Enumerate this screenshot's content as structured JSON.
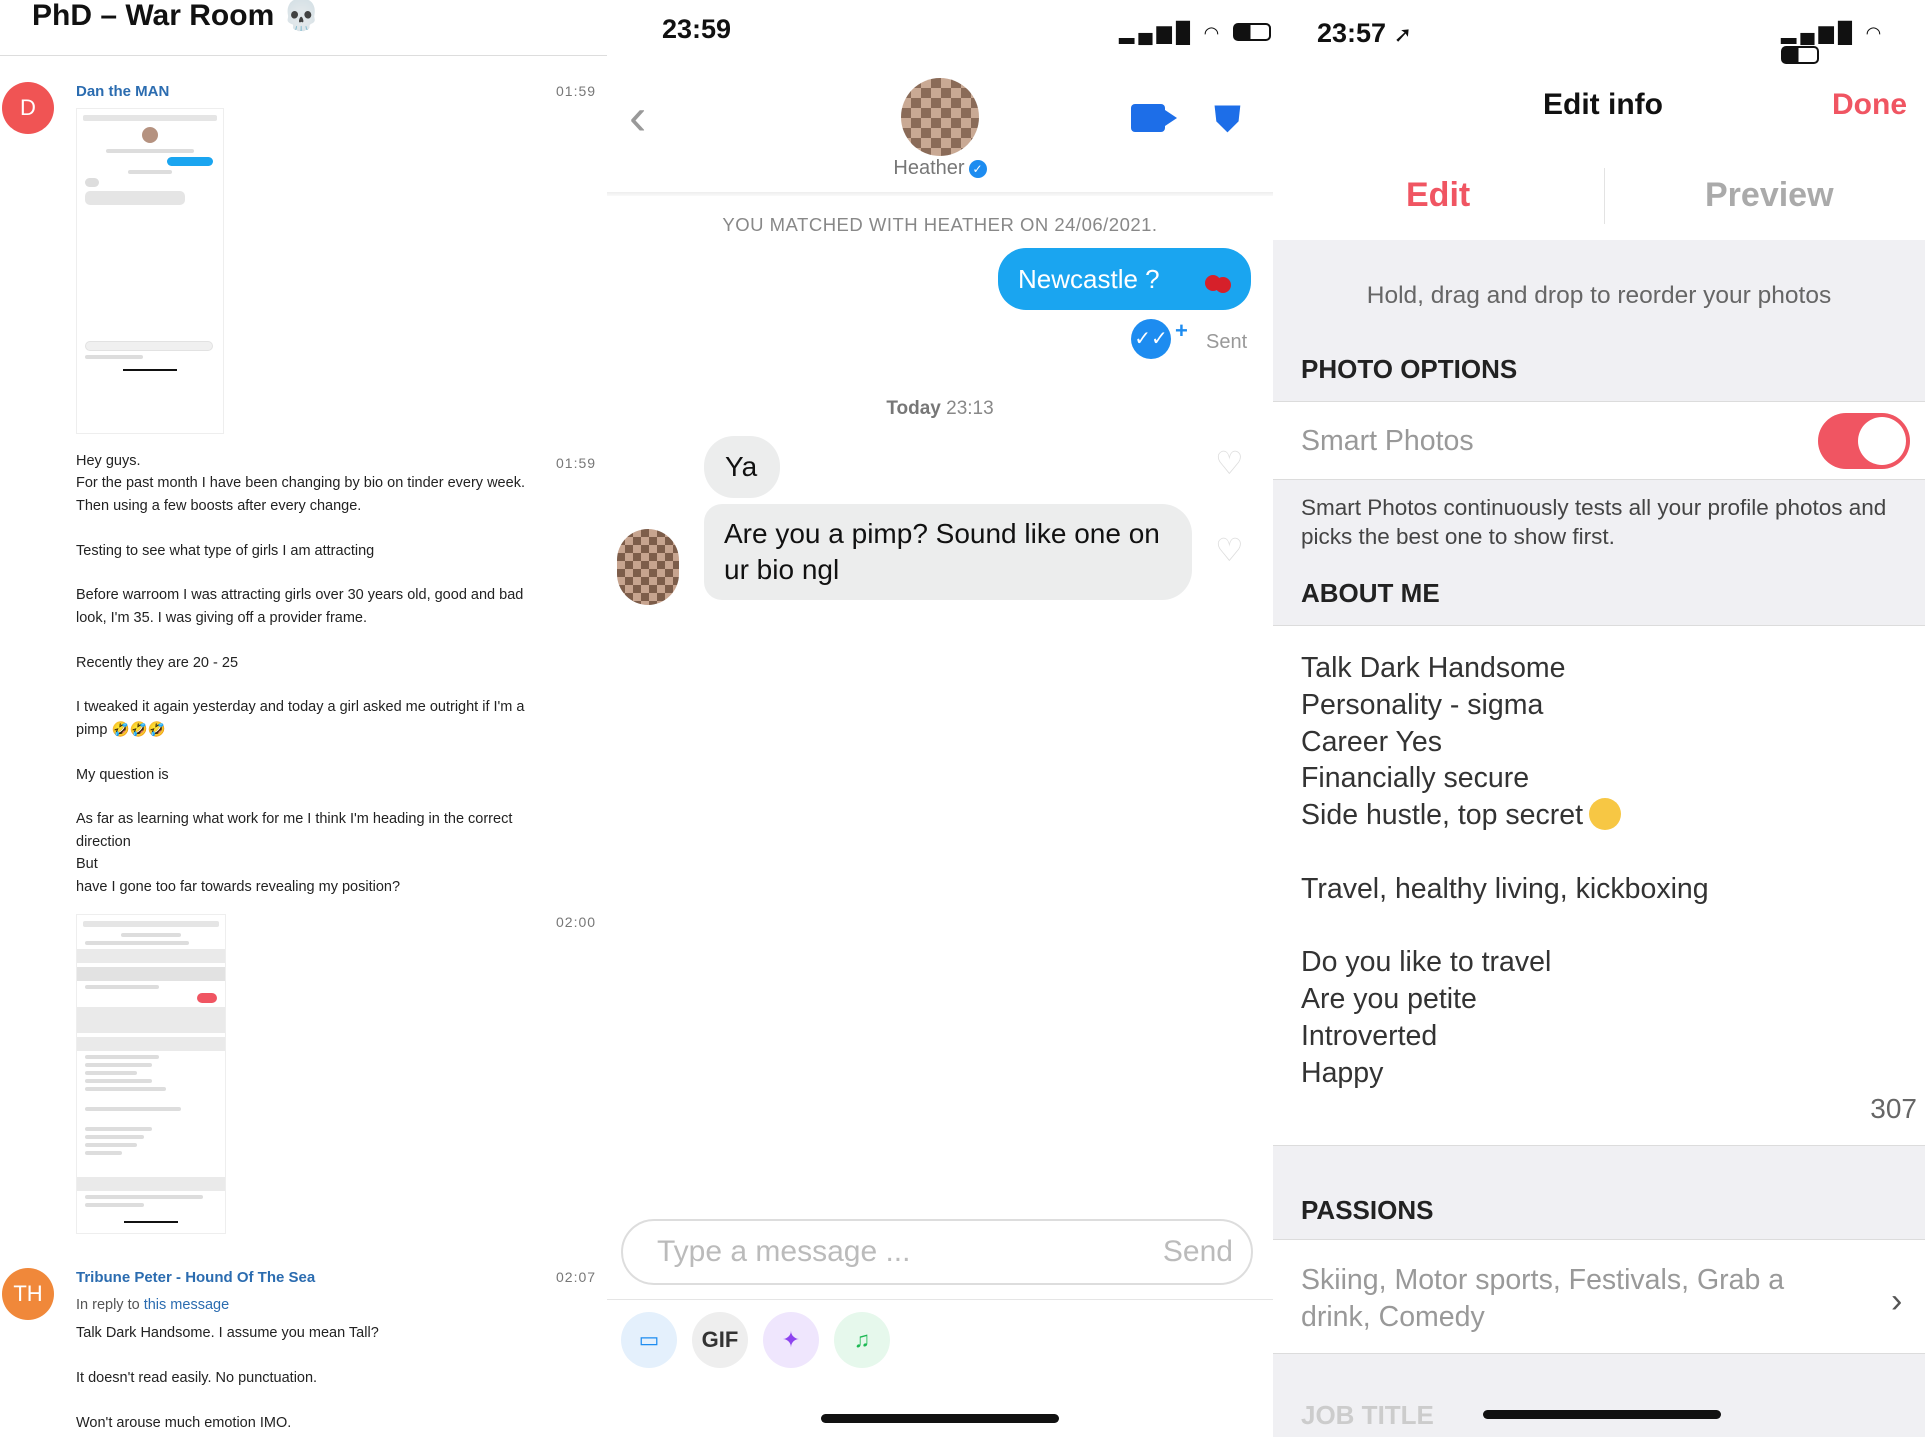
{
  "chat": {
    "title": "PhD – War Room 💀",
    "messages": [
      {
        "avatar_initial": "D",
        "sender": "Dan the MAN",
        "time_screenshot": "01:59",
        "time": "01:59",
        "lines": [
          "Hey guys.",
          "For the past month I have been changing by bio on tinder every week.",
          "Then using a few boosts after every change.",
          "",
          "Testing to see what type of girls I am attracting",
          "",
          "Before warroom I was attracting girls over 30 years old, good and bad",
          "look, I'm 35. I was giving off a provider frame.",
          "",
          "Recently they are 20 - 25",
          "",
          "I tweaked it again yesterday and today a girl asked me outright if I'm a",
          "pimp 🤣🤣🤣",
          "",
          "My question is",
          "",
          "As far as learning what work for me I think I'm heading in the correct",
          "direction",
          "But",
          "have I gone too far towards revealing my position?"
        ],
        "time_second_screenshot": "02:00"
      },
      {
        "avatar_initial": "TH",
        "sender": "Tribune Peter - Hound Of The Sea",
        "time": "02:07",
        "reply_prefix": "In reply to",
        "reply_link": "this message",
        "lines": [
          "Talk Dark Handsome. I assume you mean Tall?",
          "",
          "It doesn't read easily. No punctuation.",
          "",
          "Won't arouse much emotion IMO."
        ]
      }
    ]
  },
  "tinder_chat": {
    "status_time": "23:59",
    "match_name": "Heather",
    "matched_line": "YOU MATCHED WITH HEATHER ON 24/06/2021.",
    "outgoing_message": "Newcastle ?",
    "sent_label": "Sent",
    "day_label": "Today",
    "day_time": "23:13",
    "incoming_messages": [
      "Ya",
      "Are you a pimp? Sound like one on ur bio ngl"
    ],
    "input_placeholder": "Type a message ...",
    "send_label": "Send",
    "gif_label": "GIF"
  },
  "edit_info": {
    "status_time": "23:57",
    "title": "Edit info",
    "done_label": "Done",
    "tabs": [
      "Edit",
      "Preview"
    ],
    "reorder_hint": "Hold, drag and drop to reorder your photos",
    "photo_options_header": "PHOTO OPTIONS",
    "smart_photos_label": "Smart Photos",
    "smart_photos_on": true,
    "smart_photos_desc": "Smart Photos continuously tests all your profile photos and picks the best one to show first.",
    "about_header": "ABOUT ME",
    "bio_lines": [
      "Talk Dark Handsome",
      "Personality - sigma",
      "Career Yes",
      "Financially secure",
      "Side hustle, top secret",
      "",
      "Travel, healthy living, kickboxing",
      "",
      "Do you like to travel",
      "Are you petite",
      "Introverted",
      "Happy"
    ],
    "char_remaining": "307",
    "passions_header": "PASSIONS",
    "passions_value": "Skiing, Motor sports, Festivals, Grab a drink, Comedy",
    "job_title_header": "JOB TITLE"
  },
  "colors": {
    "tinder_blue": "#1aa5f0",
    "tinder_red": "#f05562",
    "link_blue": "#2b6cb0",
    "avatar_d": "#f05454",
    "avatar_th": "#f0883a"
  }
}
